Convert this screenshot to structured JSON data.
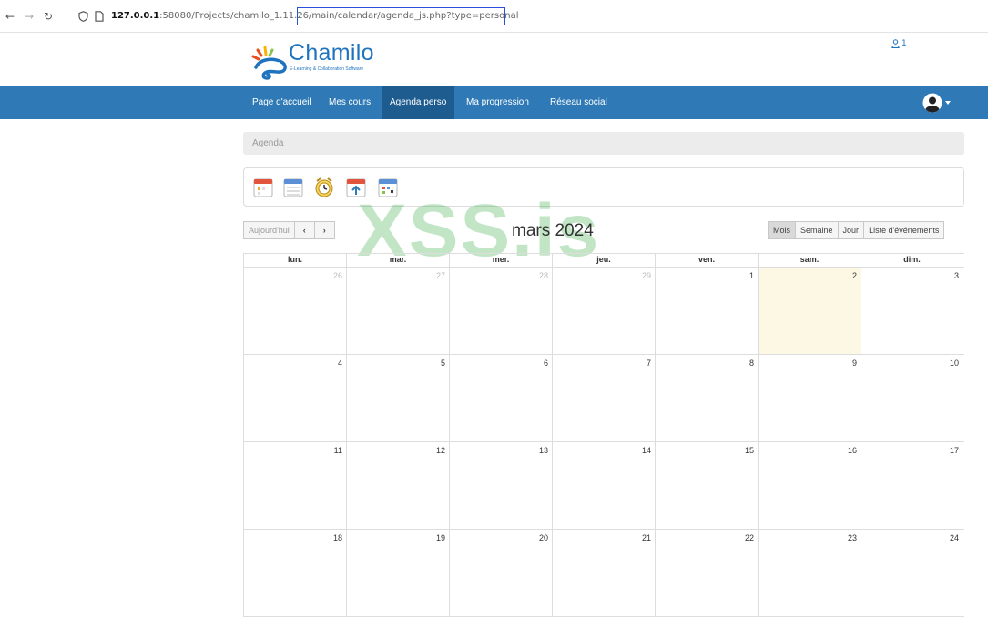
{
  "browser": {
    "url_host": "127.0.0.1",
    "url_rest": ":58080/Projects/chamilo_1.11.26/main/calendar/agenda_js.php?type=personal"
  },
  "header": {
    "logo_text": "Chamilo",
    "logo_subtitle": "E-Learning & Collaboration Software",
    "online_count": "1"
  },
  "nav": {
    "items": [
      {
        "label": "Page d'accueil"
      },
      {
        "label": "Mes cours"
      },
      {
        "label": "Agenda perso"
      },
      {
        "label": "Ma progression"
      },
      {
        "label": "Réseau social"
      }
    ],
    "active_index": 2
  },
  "breadcrumb": "Agenda",
  "toolbar": {
    "icons": [
      "add-event-icon",
      "calendar-list-icon",
      "sessions-planning-icon",
      "import-icon",
      "export-icon"
    ]
  },
  "calendar": {
    "today_label": "Aujourd'hui",
    "prev_symbol": "‹",
    "next_symbol": "›",
    "title": "mars 2024",
    "views": [
      "Mois",
      "Semaine",
      "Jour",
      "Liste d'événements"
    ],
    "active_view": "Mois",
    "weekdays": [
      "lun.",
      "mar.",
      "mer.",
      "jeu.",
      "ven.",
      "sam.",
      "dim."
    ],
    "weeks": [
      [
        {
          "d": "26",
          "other": true
        },
        {
          "d": "27",
          "other": true
        },
        {
          "d": "28",
          "other": true
        },
        {
          "d": "29",
          "other": true
        },
        {
          "d": "1"
        },
        {
          "d": "2",
          "today": true
        },
        {
          "d": "3"
        }
      ],
      [
        {
          "d": "4"
        },
        {
          "d": "5"
        },
        {
          "d": "6"
        },
        {
          "d": "7"
        },
        {
          "d": "8"
        },
        {
          "d": "9"
        },
        {
          "d": "10"
        }
      ],
      [
        {
          "d": "11"
        },
        {
          "d": "12"
        },
        {
          "d": "13"
        },
        {
          "d": "14"
        },
        {
          "d": "15"
        },
        {
          "d": "16"
        },
        {
          "d": "17"
        }
      ],
      [
        {
          "d": "18"
        },
        {
          "d": "19"
        },
        {
          "d": "20"
        },
        {
          "d": "21"
        },
        {
          "d": "22"
        },
        {
          "d": "23"
        },
        {
          "d": "24"
        }
      ]
    ]
  },
  "watermark": "XSS.is",
  "colors": {
    "navbar": "#2f7ab6",
    "nav_active": "#1e5c8f",
    "brand": "#1e73be",
    "today_bg": "#fcf8e3",
    "url_highlight": "#2b4fd8"
  }
}
